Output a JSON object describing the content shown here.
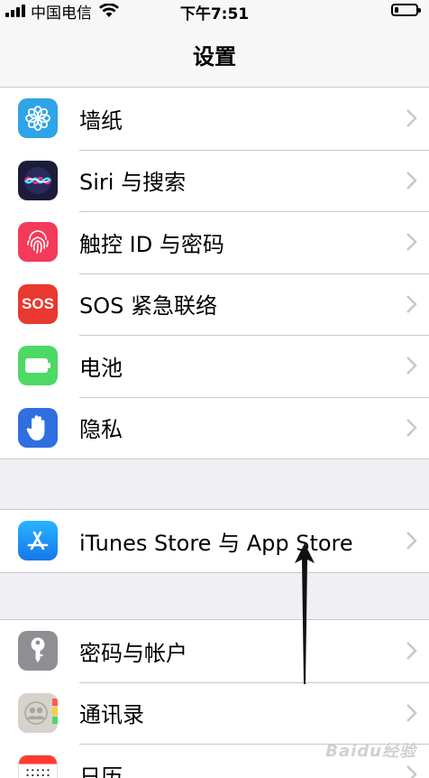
{
  "status_bar": {
    "carrier": "中国电信",
    "time": "下午7:51"
  },
  "nav": {
    "title": "设置"
  },
  "groups": [
    {
      "items": [
        {
          "label": "墙纸",
          "icon": "wallpaper-icon",
          "color": "#2fa4e7"
        },
        {
          "label": "Siri 与搜索",
          "icon": "siri-icon",
          "color": "#1c1c3a"
        },
        {
          "label": "触控 ID 与密码",
          "icon": "fingerprint-icon",
          "color": "#f43a5a"
        },
        {
          "label": "SOS 紧急联络",
          "icon": "sos-icon",
          "color": "#e8382f",
          "icon_text": "SOS"
        },
        {
          "label": "电池",
          "icon": "battery-icon",
          "color": "#4cd964"
        },
        {
          "label": "隐私",
          "icon": "hand-icon",
          "color": "#2f6fe0"
        }
      ]
    },
    {
      "items": [
        {
          "label": "iTunes Store 与 App Store",
          "icon": "app-store-icon",
          "color": "#1e9cf0"
        }
      ]
    },
    {
      "items": [
        {
          "label": "密码与帐户",
          "icon": "key-icon",
          "color": "#8e8e93"
        },
        {
          "label": "通讯录",
          "icon": "contacts-icon",
          "color": "#c9c6c0"
        },
        {
          "label": "日历",
          "icon": "calendar-icon",
          "color": "#ffffff"
        }
      ]
    }
  ],
  "watermark": "Baidu经验"
}
